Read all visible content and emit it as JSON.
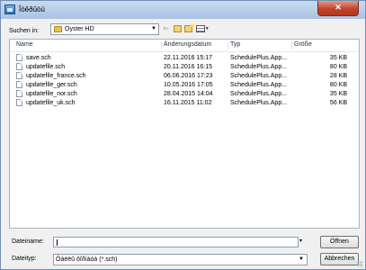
{
  "window": {
    "title": "Îòêðûòü"
  },
  "toolbar": {
    "look_in_label": "Suchen in:",
    "location": "Oyster HD"
  },
  "columns": {
    "name": "Name",
    "date": "Änderungsdatum",
    "type": "Typ",
    "size": "Größe"
  },
  "files": [
    {
      "name": "save.sch",
      "date": "22.11.2016 15:17",
      "type": "SchedulePlus.App...",
      "size": "35 KB"
    },
    {
      "name": "updatefile.sch",
      "date": "20.11.2016 16:15",
      "type": "SchedulePlus.App...",
      "size": "80 KB"
    },
    {
      "name": "updatefile_france.sch",
      "date": "06.06.2016 17:23",
      "type": "SchedulePlus.App...",
      "size": "28 KB"
    },
    {
      "name": "updatefile_ger.sch",
      "date": "10.05.2016 17:05",
      "type": "SchedulePlus.App...",
      "size": "80 KB"
    },
    {
      "name": "updatefile_nor.sch",
      "date": "28.04.2015 14:04",
      "type": "SchedulePlus.App...",
      "size": "35 KB"
    },
    {
      "name": "updatefile_uk.sch",
      "date": "16.11.2015 11:02",
      "type": "SchedulePlus.App...",
      "size": "56 KB"
    }
  ],
  "bottom": {
    "filename_label": "Dateiname:",
    "filename_value": "",
    "filetype_label": "Dateityp:",
    "filetype_value": "Ôàéëû ôîðìàòà (*.sch)",
    "open_label": "Öffnen",
    "cancel_label": "Abbrechen"
  }
}
